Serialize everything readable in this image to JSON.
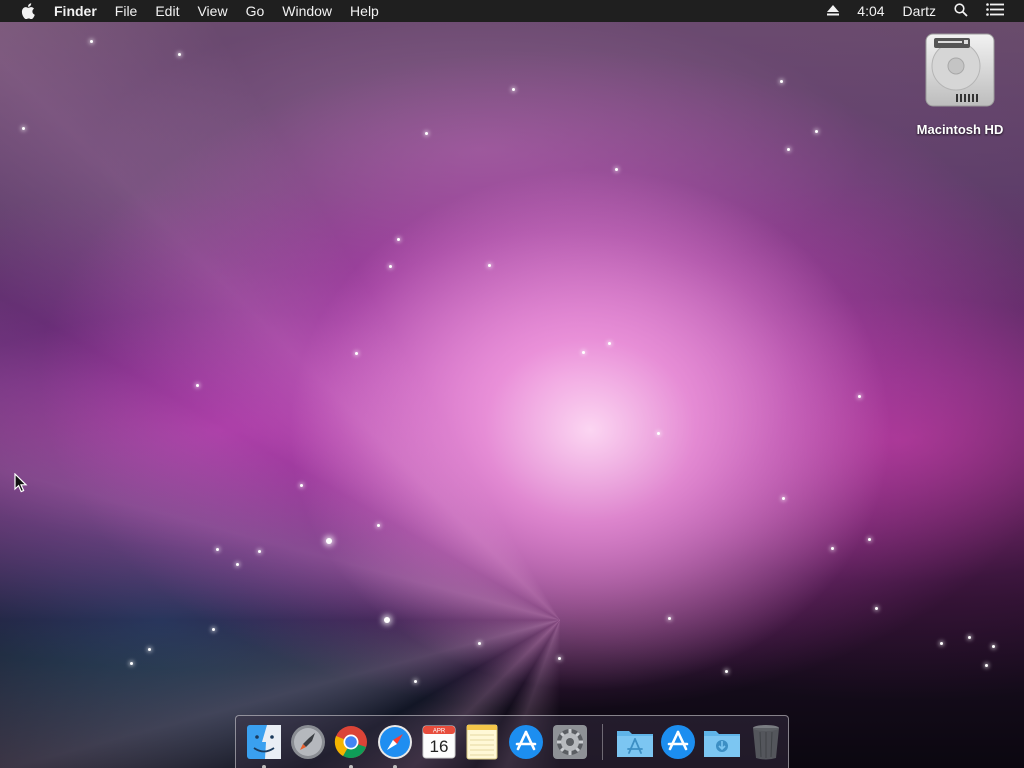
{
  "menubar": {
    "app_name": "Finder",
    "items": [
      "File",
      "Edit",
      "View",
      "Go",
      "Window",
      "Help"
    ],
    "clock": "4:04",
    "user": "Dartz"
  },
  "desktop": {
    "icons": [
      {
        "label": "Macintosh HD",
        "icon": "hard-drive-icon"
      }
    ]
  },
  "dock": {
    "apps": [
      {
        "name": "finder",
        "icon": "finder-icon",
        "running": true
      },
      {
        "name": "launchpad",
        "icon": "launchpad-icon",
        "running": false
      },
      {
        "name": "chrome",
        "icon": "chrome-icon",
        "running": true
      },
      {
        "name": "safari",
        "icon": "safari-icon",
        "running": true
      },
      {
        "name": "calendar",
        "icon": "calendar-icon",
        "running": false,
        "month": "APR",
        "day": "16"
      },
      {
        "name": "notes",
        "icon": "notes-icon",
        "running": false
      },
      {
        "name": "app-store",
        "icon": "app-store-icon",
        "running": false
      },
      {
        "name": "system-preferences",
        "icon": "gear-icon",
        "running": false
      }
    ],
    "stacks": [
      {
        "name": "applications",
        "icon": "applications-folder-icon"
      },
      {
        "name": "app-store-stack",
        "icon": "app-store-icon"
      },
      {
        "name": "downloads",
        "icon": "downloads-folder-icon"
      },
      {
        "name": "trash",
        "icon": "trash-icon"
      }
    ]
  },
  "colors": {
    "menubar_bg": "#1f1f1f",
    "menubar_text": "#f2f2f2"
  }
}
